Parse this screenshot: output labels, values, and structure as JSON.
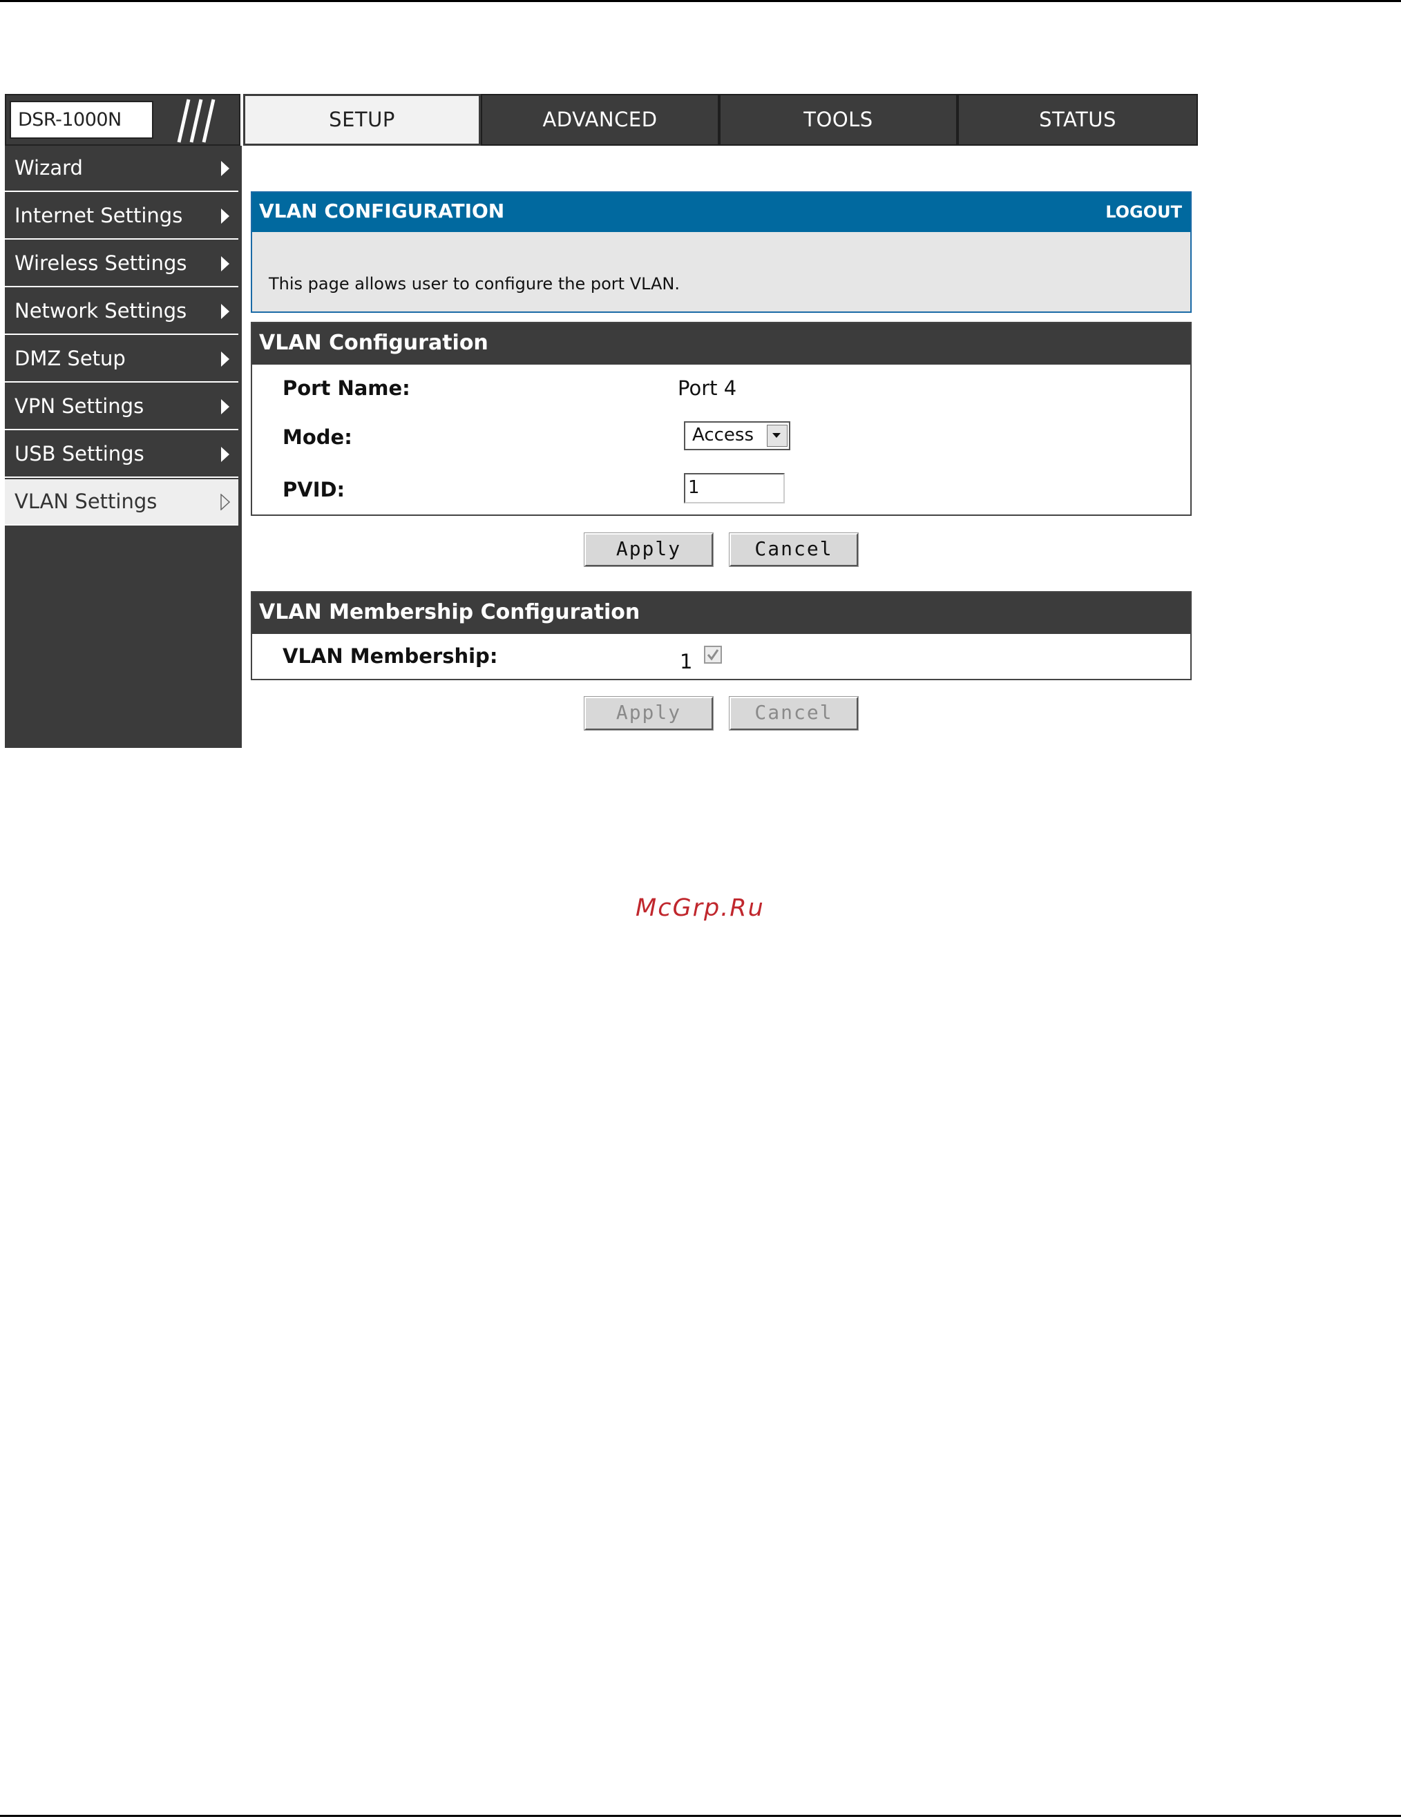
{
  "brand": {
    "model": "DSR-1000N"
  },
  "tabs": [
    {
      "label": "SETUP",
      "active": true
    },
    {
      "label": "ADVANCED",
      "active": false
    },
    {
      "label": "TOOLS",
      "active": false
    },
    {
      "label": "STATUS",
      "active": false
    }
  ],
  "sidebar": {
    "items": [
      {
        "label": "Wizard"
      },
      {
        "label": "Internet Settings"
      },
      {
        "label": "Wireless Settings"
      },
      {
        "label": "Network Settings"
      },
      {
        "label": "DMZ Setup"
      },
      {
        "label": "VPN Settings"
      },
      {
        "label": "USB Settings"
      },
      {
        "label": "VLAN Settings",
        "active": true
      }
    ]
  },
  "banner": {
    "title": "VLAN CONFIGURATION",
    "logout": "LOGOUT",
    "description": "This page allows user to configure the port VLAN."
  },
  "vlan_config": {
    "title": "VLAN Configuration",
    "port_name_label": "Port Name:",
    "port_name_value": "Port 4",
    "mode_label": "Mode:",
    "mode_value": "Access",
    "pvid_label": "PVID:",
    "pvid_value": "1",
    "apply_label": "Apply",
    "cancel_label": "Cancel"
  },
  "vlan_membership": {
    "title": "VLAN Membership Configuration",
    "label": "VLAN Membership:",
    "vlan_id": "1",
    "checked": true,
    "apply_label": "Apply",
    "cancel_label": "Cancel"
  },
  "watermark": "McGrp.Ru",
  "colors": {
    "banner_blue": "#01699f",
    "nav_dark": "#3c3c3c",
    "watermark_red": "#c0272d"
  }
}
